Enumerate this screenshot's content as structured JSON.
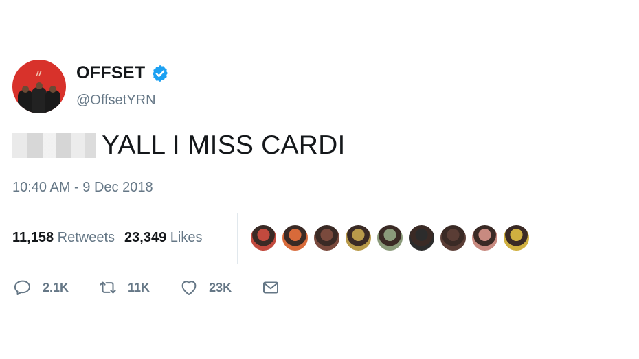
{
  "author": {
    "display_name": "OFFSET",
    "handle": "@OffsetYRN",
    "avatar_icon": "profile-photo-avatar",
    "verified_icon": "verified-badge-icon",
    "verified_color": "#1da1f2",
    "avatar_bg": "#d8322b"
  },
  "tweet": {
    "text": "YALL I MISS CARDI",
    "redacted_prefix": true,
    "timestamp": "10:40 AM - 9 Dec 2018"
  },
  "stats": {
    "retweets_count": "11,158",
    "retweets_label": "Retweets",
    "likes_count": "23,349",
    "likes_label": "Likes"
  },
  "likers": [
    {
      "icon": "liker-avatar-1",
      "color": "#c24a3e"
    },
    {
      "icon": "liker-avatar-2",
      "color": "#d86a3a"
    },
    {
      "icon": "liker-avatar-3",
      "color": "#7a4a3d"
    },
    {
      "icon": "liker-avatar-4",
      "color": "#b89a4a"
    },
    {
      "icon": "liker-avatar-5",
      "color": "#8a9a7a"
    },
    {
      "icon": "liker-avatar-6",
      "color": "#2c2c2c"
    },
    {
      "icon": "liker-avatar-7",
      "color": "#5a3d35"
    },
    {
      "icon": "liker-avatar-8",
      "color": "#c88a80"
    },
    {
      "icon": "liker-avatar-9",
      "color": "#d0b040"
    }
  ],
  "actions": {
    "reply_count": "2.1K",
    "retweet_count": "11K",
    "like_count": "23K",
    "icon_color": "#657786"
  }
}
